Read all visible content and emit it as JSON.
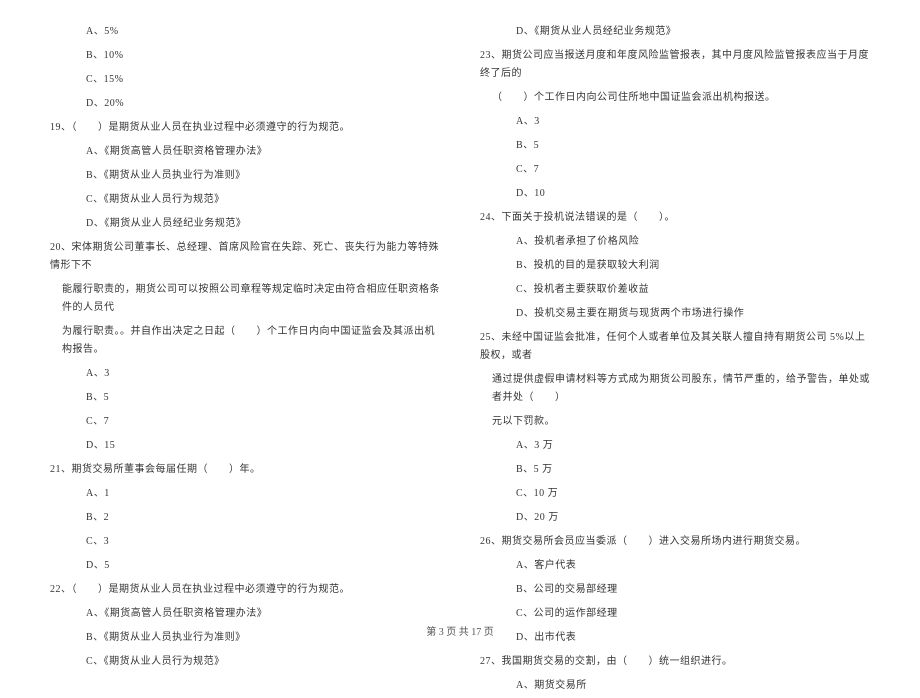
{
  "left": {
    "q18_options": [
      "A、5%",
      "B、10%",
      "C、15%",
      "D、20%"
    ],
    "q19": {
      "stem": "19、（　　）是期货从业人员在执业过程中必须遵守的行为规范。",
      "options": [
        "A、《期货高管人员任职资格管理办法》",
        "B、《期货从业人员执业行为准则》",
        "C、《期货从业人员行为规范》",
        "D、《期货从业人员经纪业务规范》"
      ]
    },
    "q20": {
      "stem1": "20、宋体期货公司董事长、总经理、首席风险官在失踪、死亡、丧失行为能力等特殊情形下不",
      "stem2": "能履行职责的，期货公司可以按照公司章程等规定临时决定由符合相应任职资格条件的人员代",
      "stem3": "为履行职责。。并自作出决定之日起（　　）个工作日内向中国证监会及其派出机构报告。",
      "options": [
        "A、3",
        "B、5",
        "C、7",
        "D、15"
      ]
    },
    "q21": {
      "stem": "21、期货交易所董事会每届任期（　　）年。",
      "options": [
        "A、1",
        "B、2",
        "C、3",
        "D、5"
      ]
    },
    "q22": {
      "stem": "22、（　　）是期货从业人员在执业过程中必须遵守的行为规范。",
      "options": [
        "A、《期货高管人员任职资格管理办法》",
        "B、《期货从业人员执业行为准则》",
        "C、《期货从业人员行为规范》"
      ]
    }
  },
  "right": {
    "q22_cont_option": "D、《期货从业人员经纪业务规范》",
    "q23": {
      "stem1": "23、期货公司应当报送月度和年度风险监管报表，其中月度风险监管报表应当于月度终了后的",
      "stem2": "（　　）个工作日内向公司住所地中国证监会派出机构报送。",
      "options": [
        "A、3",
        "B、5",
        "C、7",
        "D、10"
      ]
    },
    "q24": {
      "stem": "24、下面关于投机说法错误的是（　　）。",
      "options": [
        "A、投机者承担了价格风险",
        "B、投机的目的是获取较大利润",
        "C、投机者主要获取价差收益",
        "D、投机交易主要在期货与现货两个市场进行操作"
      ]
    },
    "q25": {
      "stem1": "25、未经中国证监会批准，任何个人或者单位及其关联人擅自持有期货公司 5%以上股权，或者",
      "stem2": "通过提供虚假申请材料等方式成为期货公司股东，情节严重的，给予警告，单处或者并处（　　）",
      "stem3": "元以下罚款。",
      "options": [
        "A、3 万",
        "B、5 万",
        "C、10 万",
        "D、20 万"
      ]
    },
    "q26": {
      "stem": "26、期货交易所会员应当委派（　　）进入交易所场内进行期货交易。",
      "options": [
        "A、客户代表",
        "B、公司的交易部经理",
        "C、公司的运作部经理",
        "D、出市代表"
      ]
    },
    "q27": {
      "stem": "27、我国期货交易的交割，由（　　）统一组织进行。",
      "options": [
        "A、期货交易所"
      ]
    }
  },
  "footer": "第 3 页 共 17 页"
}
